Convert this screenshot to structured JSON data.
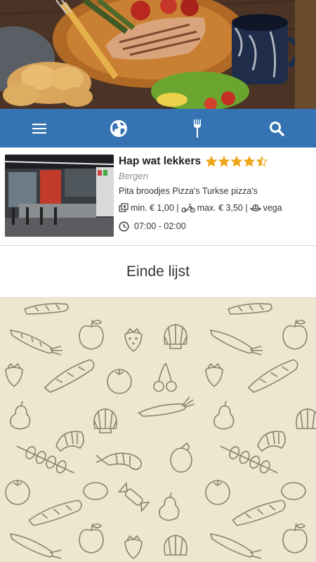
{
  "header": {
    "hero_alt": "Gerechten"
  },
  "navbar": {
    "menu_icon": "menu-icon",
    "globe_icon": "globe-icon",
    "fork_icon": "fork-icon",
    "search_icon": "search-icon",
    "color": "#3573b3"
  },
  "list": {
    "items": [
      {
        "name": "Hap wat lekkers",
        "rating": 4.5,
        "city": "Bergen",
        "categories": "Pita broodjes Pizza's Turkse pizza's",
        "min_order": "min. € 1,00 |",
        "delivery": "max.  € 3,50 |",
        "diet": "vega",
        "hours": "07:00 - 02:00"
      }
    ],
    "end_text": "Einde lijst"
  },
  "colors": {
    "star": "#f0a81a",
    "background": "#efe6cf",
    "pattern_stroke": "#8a8270"
  }
}
